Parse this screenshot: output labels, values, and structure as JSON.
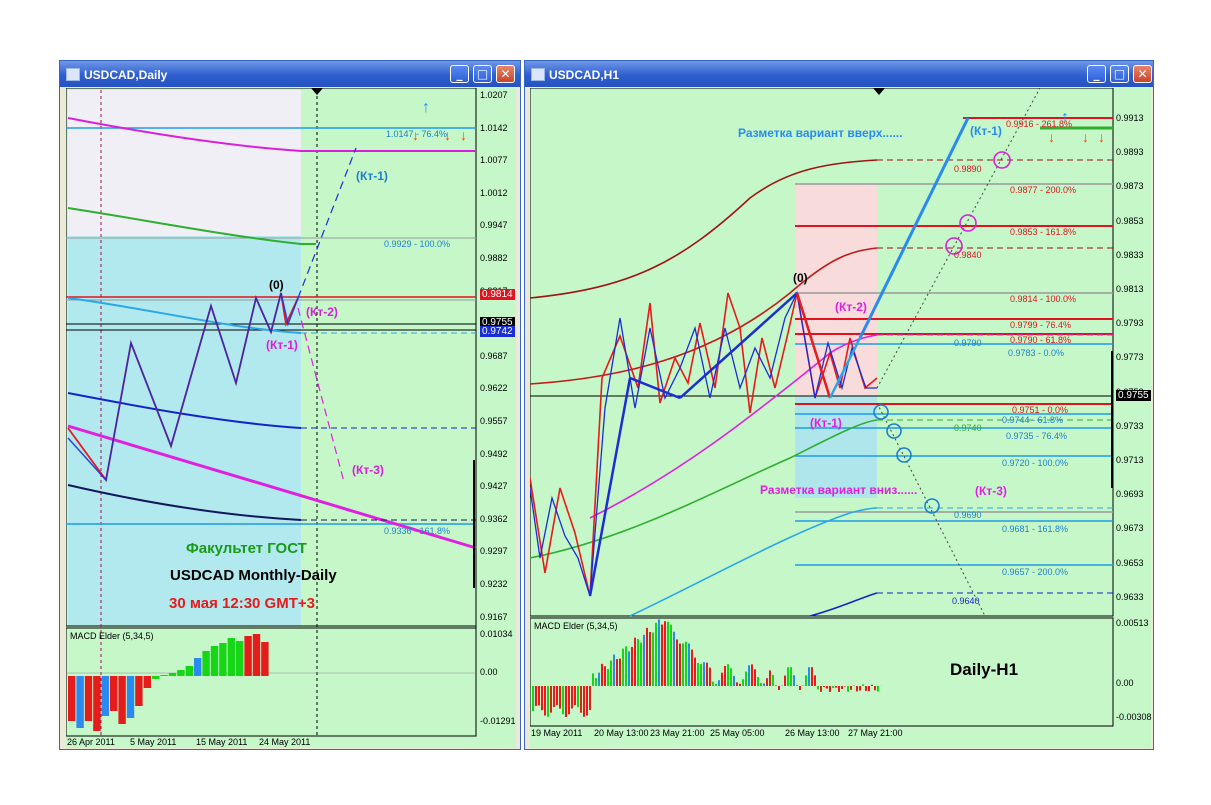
{
  "left_window": {
    "title": "USDCAD,Daily",
    "price_axis": [
      "1.0207",
      "1.0142",
      "1.0077",
      "1.0012",
      "0.9947",
      "0.9882",
      "0.9817",
      "0.9752",
      "0.9687",
      "0.9622",
      "0.9557",
      "0.9492",
      "0.9427",
      "0.9362",
      "0.9297",
      "0.9232",
      "0.9167"
    ],
    "price_badges": {
      "red": "0.9814",
      "green": "0.9814",
      "black": "0.9755",
      "blue": "0.9742"
    },
    "fib_labels": [
      "1.0147 - 76.4%",
      "0.9929 - 100.0%",
      "0.9336 - 161.8%"
    ],
    "wave_labels": [
      "(Кт-1)",
      "(Кт-2)",
      "(Кт-1)",
      "(Кт-3)"
    ],
    "pivot_label": "(0)",
    "caption": {
      "line1": "Факультет ГОСТ",
      "line2": "USDCAD Monthly-Daily",
      "line3": "30 мая 12:30 GMT+3"
    },
    "macd": {
      "label": "MACD Elder (5,34,5)",
      "axis": [
        "0.01034",
        "0.00",
        "-0.01291"
      ]
    },
    "time_axis": [
      "26 Apr 2011",
      "5 May 2011",
      "15 May 2011",
      "24 May 2011"
    ]
  },
  "right_window": {
    "title": "USDCAD,H1",
    "price_axis": [
      "0.9913",
      "0.9893",
      "0.9873",
      "0.9853",
      "0.9833",
      "0.9813",
      "0.9793",
      "0.9773",
      "0.9753",
      "0.9733",
      "0.9713",
      "0.9693",
      "0.9673",
      "0.9653",
      "0.9633"
    ],
    "price_badge": "0.9755",
    "headings": {
      "up": "Разметка вариант вверх......",
      "down": "Разметка вариант вниз......"
    },
    "wave_labels": {
      "kt1_top": "(Кт-1)",
      "kt2": "(Кт-2)",
      "kt1_low": "(Кт-1)",
      "kt3": "(Кт-3)",
      "zero": "(0)"
    },
    "level_labels": [
      "0.9916 - 261.8%",
      "0.9890",
      "0.9877 - 200.0%",
      "0.9853 - 161.8%",
      "0.9840",
      "0.9814 - 100.0%",
      "0.9799 - 76.4%",
      "0.9790 - 61.8%",
      "0.9790",
      "0.9783 - 0.0%",
      "0.9751 - 0.0%",
      "0.9744 - 61.8%",
      "0.9740",
      "0.9735 - 76.4%",
      "0.9720 - 100.0%",
      "0.9690",
      "0.9681 - 161.8%",
      "0.9657 - 200.0%",
      "0.9640"
    ],
    "macd": {
      "label": "MACD Elder (5,34,5)",
      "axis": [
        "0.00513",
        "0.00",
        "-0.00308"
      ]
    },
    "timeframe_caption": "Daily-H1",
    "time_axis": [
      "19 May 2011",
      "20 May 13:00",
      "23 May 21:00",
      "25 May 05:00",
      "26 May 13:00",
      "27 May 21:00"
    ]
  },
  "colors": {
    "chart_bg": "#c5f7c9",
    "title_blue": "#2f5fd0",
    "bull_bar": "#17d617",
    "bear_bar": "#e51c1c",
    "mid_bar": "#2a8af0"
  }
}
